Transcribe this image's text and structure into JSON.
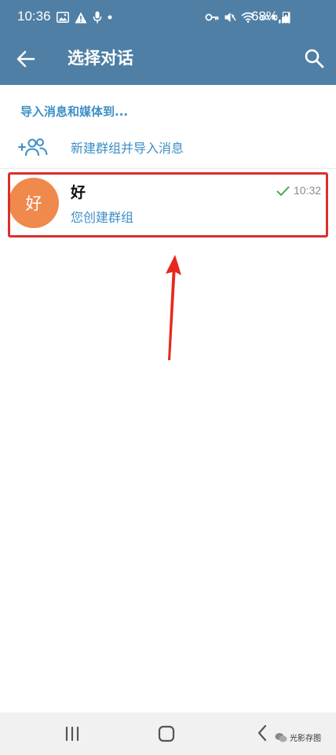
{
  "status_bar": {
    "time": "10:36",
    "network_label": "3G R",
    "battery_percent": "68%"
  },
  "app_bar": {
    "title": "选择对话",
    "back_icon": "arrow-left-icon",
    "search_icon": "search-icon"
  },
  "import_section": {
    "header": "导入消息和媒体到...",
    "new_group_label": "新建群组并导入消息",
    "new_group_icon": "add-group-icon"
  },
  "chats": [
    {
      "avatar_text": "好",
      "avatar_color": "#f0894c",
      "name": "好",
      "preview": "您创建群组",
      "time": "10:32",
      "read_status": "sent-check"
    }
  ],
  "annotation": {
    "highlight_color": "#d9302c"
  },
  "watermark": {
    "text": "光影存图"
  },
  "colors": {
    "header_bg": "#4f7fa5",
    "accent_text": "#3d8fc6"
  }
}
